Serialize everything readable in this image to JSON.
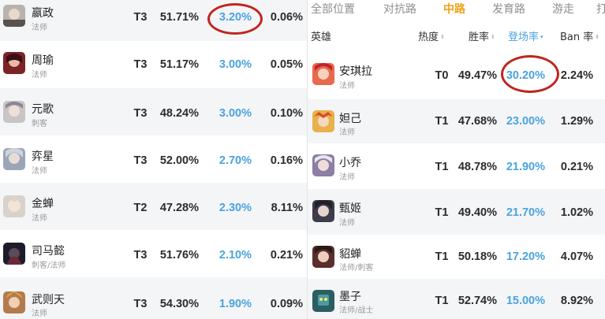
{
  "left_table": {
    "rows": [
      {
        "name": "嬴政",
        "role": "法师",
        "tier": "T3",
        "win_rate": "51.71%",
        "pick_rate": "3.20%",
        "ban_rate": "0.06%",
        "avatar": "hero-ying-zheng"
      },
      {
        "name": "周瑜",
        "role": "法师",
        "tier": "T3",
        "win_rate": "51.17%",
        "pick_rate": "3.00%",
        "ban_rate": "0.05%",
        "avatar": "hero-zhou-yu"
      },
      {
        "name": "元歌",
        "role": "刺客",
        "tier": "T3",
        "win_rate": "48.24%",
        "pick_rate": "3.00%",
        "ban_rate": "0.10%",
        "avatar": "hero-yuan-ge"
      },
      {
        "name": "弈星",
        "role": "法师",
        "tier": "T3",
        "win_rate": "52.00%",
        "pick_rate": "2.70%",
        "ban_rate": "0.16%",
        "avatar": "hero-yi-xing"
      },
      {
        "name": "金蝉",
        "role": "法师",
        "tier": "T2",
        "win_rate": "47.28%",
        "pick_rate": "2.30%",
        "ban_rate": "8.11%",
        "avatar": "hero-jin-chan"
      },
      {
        "name": "司马懿",
        "role": "刺客/法师",
        "tier": "T3",
        "win_rate": "51.76%",
        "pick_rate": "2.10%",
        "ban_rate": "0.21%",
        "avatar": "hero-sima-yi"
      },
      {
        "name": "武则天",
        "role": "法师",
        "tier": "T3",
        "win_rate": "54.30%",
        "pick_rate": "1.90%",
        "ban_rate": "0.09%",
        "avatar": "hero-wu-zetian"
      }
    ]
  },
  "right_table": {
    "tabs": [
      {
        "label": "全部位置",
        "active": false
      },
      {
        "label": "对抗路",
        "active": false
      },
      {
        "label": "中路",
        "active": true
      },
      {
        "label": "发育路",
        "active": false
      },
      {
        "label": "游走",
        "active": false
      },
      {
        "label": "打",
        "active": false
      }
    ],
    "headers": {
      "hero": "英雄",
      "heat": "热度",
      "win_rate": "胜率",
      "pick_rate": "登场率",
      "ban_rate": "Ban 率"
    },
    "sort_icons": {
      "neutral": "⬍",
      "active": "▾"
    },
    "rows": [
      {
        "name": "安琪拉",
        "role": "法师",
        "tier": "T0",
        "win_rate": "49.47%",
        "pick_rate": "30.20%",
        "ban_rate": "2.24%",
        "avatar": "hero-angela"
      },
      {
        "name": "妲己",
        "role": "法师",
        "tier": "T1",
        "win_rate": "47.68%",
        "pick_rate": "23.00%",
        "ban_rate": "1.29%",
        "avatar": "hero-da-ji"
      },
      {
        "name": "小乔",
        "role": "法师",
        "tier": "T1",
        "win_rate": "48.78%",
        "pick_rate": "21.90%",
        "ban_rate": "0.21%",
        "avatar": "hero-xiao-qiao"
      },
      {
        "name": "甄姬",
        "role": "法师",
        "tier": "T1",
        "win_rate": "49.40%",
        "pick_rate": "21.70%",
        "ban_rate": "1.02%",
        "avatar": "hero-zhen-ji"
      },
      {
        "name": "貂蝉",
        "role": "法师/刺客",
        "tier": "T1",
        "win_rate": "50.18%",
        "pick_rate": "17.20%",
        "ban_rate": "4.07%",
        "avatar": "hero-diao-chan"
      },
      {
        "name": "墨子",
        "role": "法师/战士",
        "tier": "T1",
        "win_rate": "52.74%",
        "pick_rate": "15.00%",
        "ban_rate": "8.92%",
        "avatar": "hero-mozi"
      }
    ]
  },
  "colors": {
    "accent_tab": "#f0a31a",
    "pick_rate_blue": "#4aa3df",
    "highlight_ring": "#c0251d",
    "row_alt": "#f4f5f7"
  }
}
